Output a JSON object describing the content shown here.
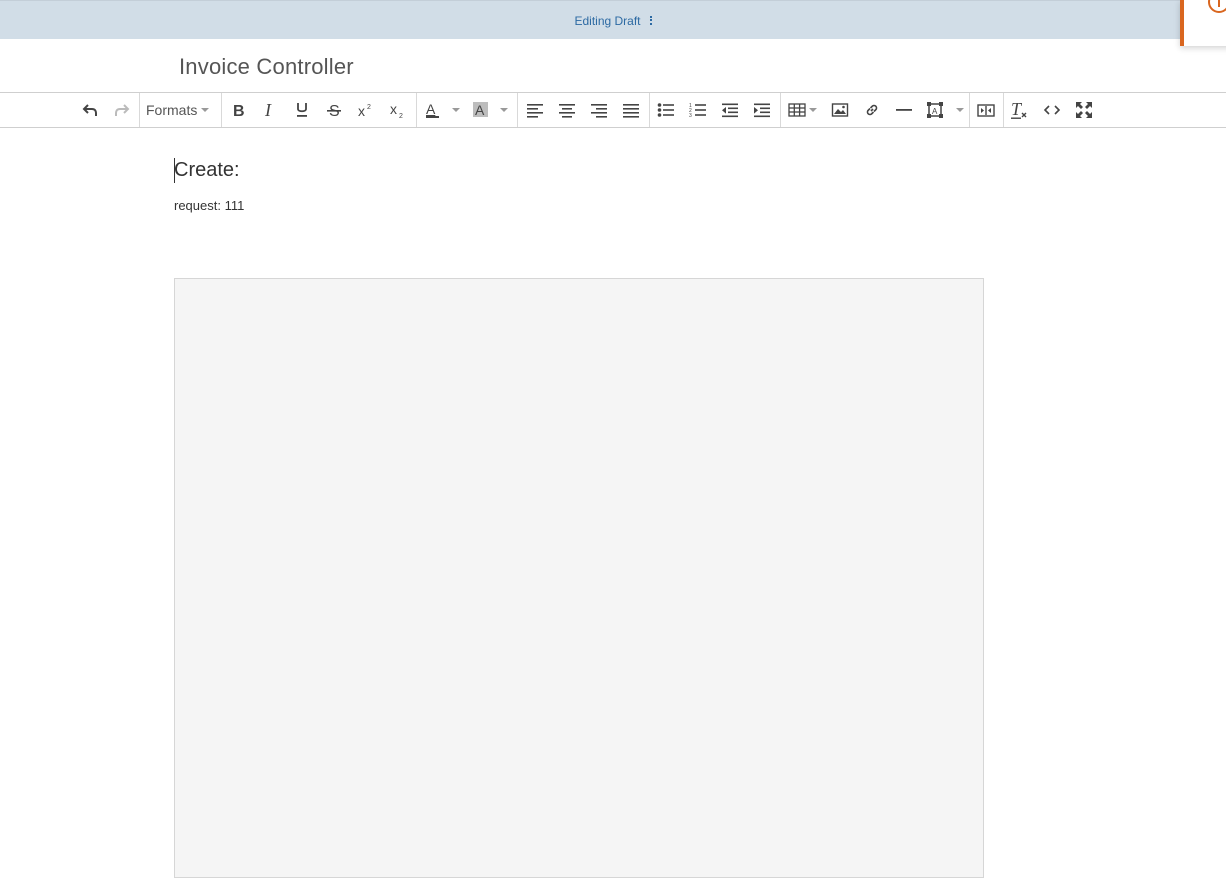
{
  "topbar": {
    "status_text": "Editing Draft",
    "menu_icon": "kebab-vertical-icon"
  },
  "notification": {
    "icon": "info-icon",
    "accent": "#d9661f"
  },
  "document": {
    "title": "Invoice Controller"
  },
  "toolbar": {
    "formats_label": "Formats",
    "buttons": [
      "undo",
      "redo",
      "formats",
      "bold",
      "italic",
      "underline",
      "strikethrough",
      "superscript",
      "subscript",
      "text-color",
      "background-color",
      "align-left",
      "align-center",
      "align-right",
      "justify",
      "bullet-list",
      "numbered-list",
      "outdent",
      "indent",
      "table",
      "image",
      "link",
      "horizontal-rule",
      "media",
      "preview",
      "clear-formatting",
      "source-code",
      "fullscreen"
    ]
  },
  "content": {
    "heading": "Create:",
    "paragraph": "request: 111"
  },
  "colors": {
    "topbar_bg": "#d1dde7",
    "status_text": "#2d6aa3",
    "embed_bg": "#f5f5f5"
  }
}
